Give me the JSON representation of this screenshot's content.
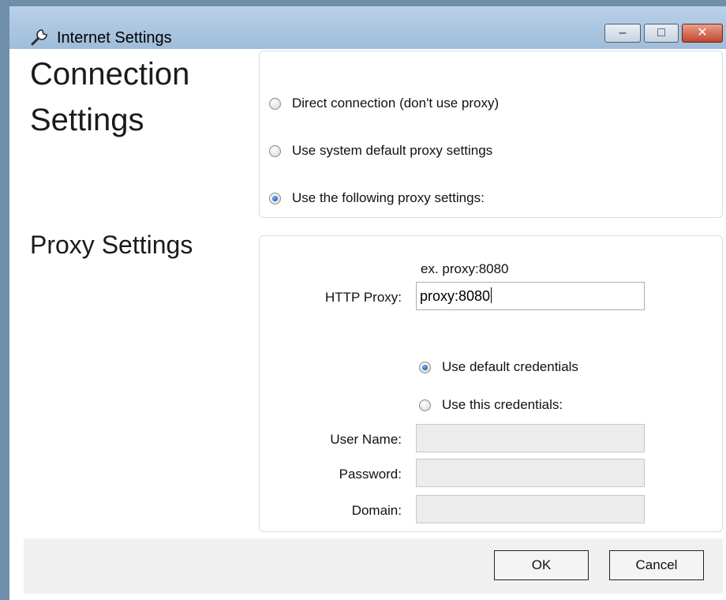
{
  "window": {
    "title": "Internet Settings",
    "buttons": {
      "minimize": "–",
      "maximize": "□",
      "close": "✕"
    }
  },
  "connection": {
    "heading_line1": "Connection",
    "heading_line2": "Settings",
    "options": [
      {
        "label": "Direct connection (don't use proxy)",
        "checked": false
      },
      {
        "label": "Use system default proxy settings",
        "checked": false
      },
      {
        "label": "Use the following proxy settings:",
        "checked": true
      }
    ]
  },
  "proxy": {
    "heading": "Proxy Settings",
    "hint": "ex. proxy:8080",
    "http_label": "HTTP Proxy:",
    "http_value": "proxy:8080",
    "credentials": [
      {
        "label": "Use default credentials",
        "checked": true
      },
      {
        "label": "Use this credentials:",
        "checked": false
      }
    ],
    "username_label": "User Name:",
    "password_label": "Password:",
    "domain_label": "Domain:"
  },
  "footer": {
    "ok_label": "OK",
    "cancel_label": "Cancel"
  }
}
